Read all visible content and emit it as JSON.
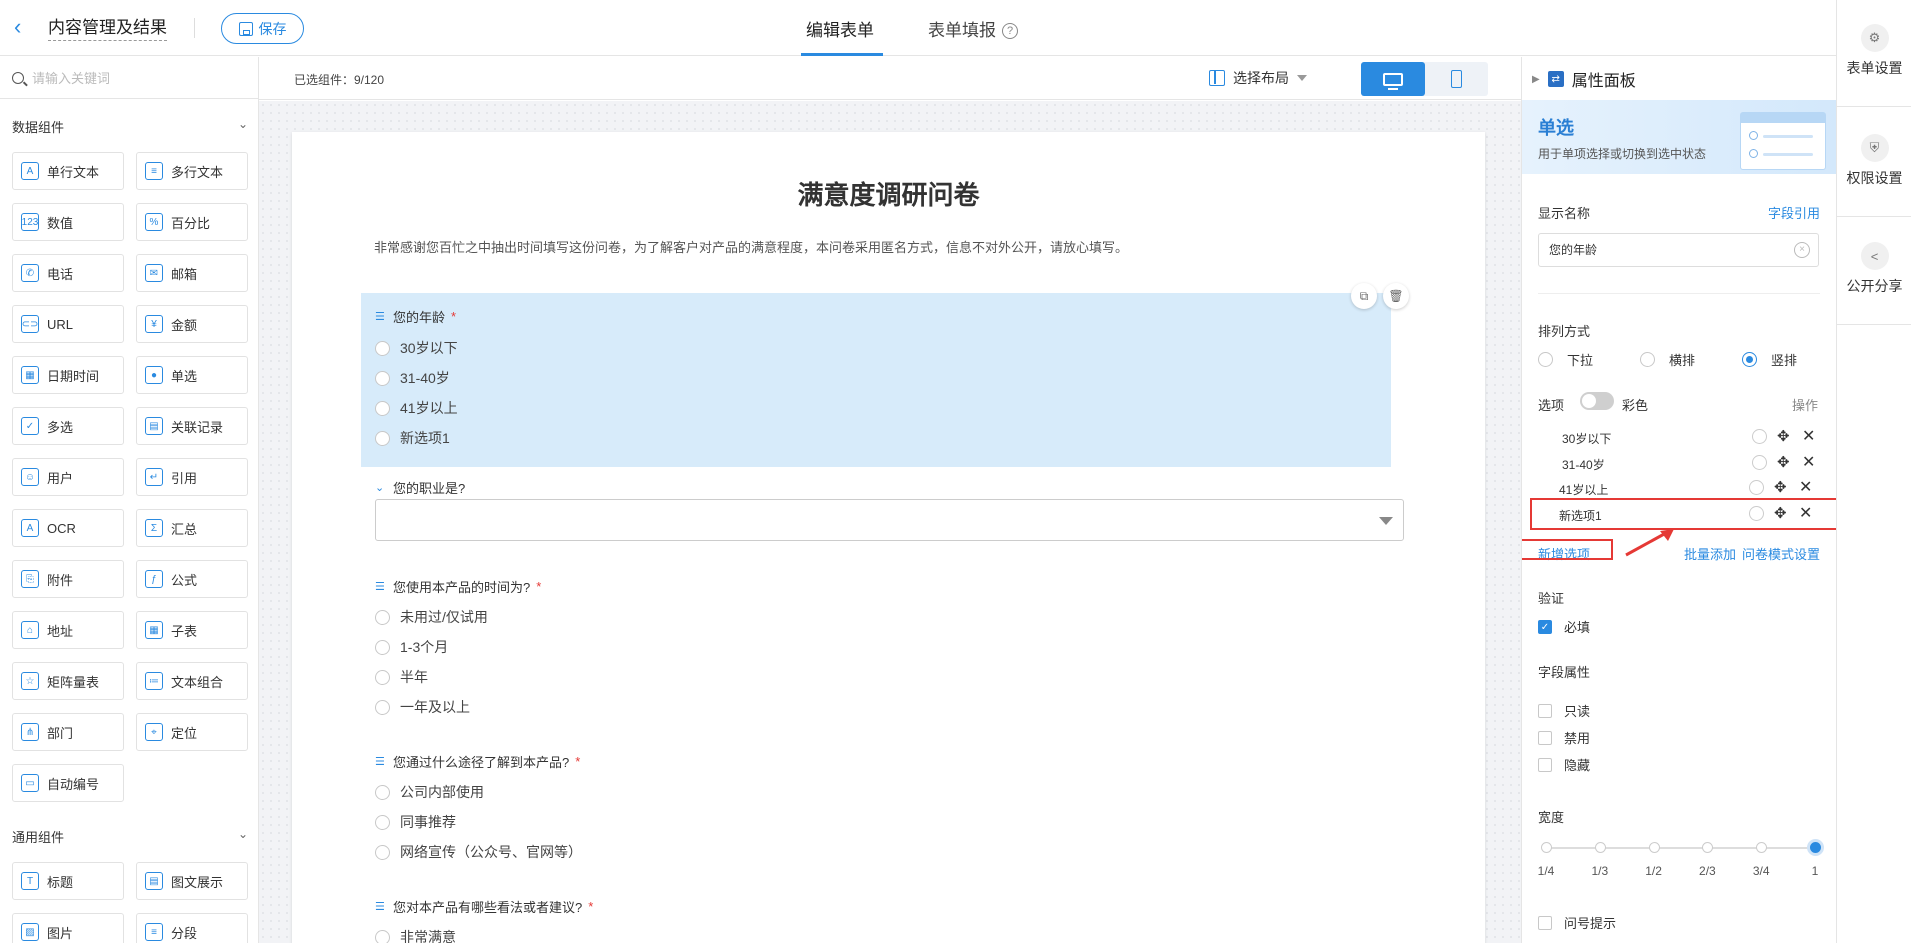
{
  "header": {
    "app_title": "内容管理及结果",
    "save_label": "保存",
    "tabs": [
      {
        "label": "编辑表单"
      },
      {
        "label": "表单填报"
      }
    ],
    "help_glyph": "?"
  },
  "right_rail": {
    "items": [
      {
        "label": "表单设置",
        "icon": "form-settings-icon"
      },
      {
        "label": "权限设置",
        "icon": "shield-icon"
      },
      {
        "label": "公开分享",
        "icon": "share-icon"
      }
    ]
  },
  "left_panel": {
    "search_placeholder": "请输入关键词",
    "section_data": "数据组件",
    "section_common": "通用组件",
    "components": [
      {
        "label": "单行文本",
        "glyph": "A"
      },
      {
        "label": "多行文本",
        "glyph": "≡"
      },
      {
        "label": "数值",
        "glyph": "123"
      },
      {
        "label": "百分比",
        "glyph": "%"
      },
      {
        "label": "电话",
        "glyph": "✆"
      },
      {
        "label": "邮箱",
        "glyph": "✉"
      },
      {
        "label": "URL",
        "glyph": "⊂⊃"
      },
      {
        "label": "金额",
        "glyph": "¥"
      },
      {
        "label": "日期时间",
        "glyph": "▦"
      },
      {
        "label": "单选",
        "glyph": "●"
      },
      {
        "label": "多选",
        "glyph": "✓"
      },
      {
        "label": "关联记录",
        "glyph": "▤"
      },
      {
        "label": "用户",
        "glyph": "☺"
      },
      {
        "label": "引用",
        "glyph": "↵"
      },
      {
        "label": "OCR",
        "glyph": "A"
      },
      {
        "label": "汇总",
        "glyph": "Σ"
      },
      {
        "label": "附件",
        "glyph": "⎘"
      },
      {
        "label": "公式",
        "glyph": "ƒ"
      },
      {
        "label": "地址",
        "glyph": "⌂"
      },
      {
        "label": "子表",
        "glyph": "▦"
      },
      {
        "label": "矩阵量表",
        "glyph": "☆"
      },
      {
        "label": "文本组合",
        "glyph": "≔"
      },
      {
        "label": "部门",
        "glyph": "⋔"
      },
      {
        "label": "定位",
        "glyph": "⌖"
      },
      {
        "label": "自动编号",
        "glyph": "▭"
      }
    ],
    "common_components": [
      {
        "label": "标题",
        "glyph": "T"
      },
      {
        "label": "图文展示",
        "glyph": "▤"
      },
      {
        "label": "图片",
        "glyph": "▨"
      },
      {
        "label": "分段",
        "glyph": "≡"
      }
    ]
  },
  "canvas_toolbar": {
    "selected_count": "已选组件：9/120",
    "layout_label": "选择布局"
  },
  "form": {
    "title": "满意度调研问卷",
    "description": "非常感谢您百忙之中抽出时间填写这份问卷，为了解客户对产品的满意程度，本问卷采用匿名方式，信息不对外公开，请放心填写。",
    "questions": [
      {
        "title": "您的年龄",
        "required": "*",
        "options": [
          "30岁以下",
          "31-40岁",
          "41岁以上",
          "新选项1"
        ]
      },
      {
        "title": "您的职业是?",
        "required": ""
      },
      {
        "title": "您使用本产品的时间为?",
        "required": "*",
        "options": [
          "未用过/仅试用",
          "1-3个月",
          "半年",
          "一年及以上"
        ]
      },
      {
        "title": "您通过什么途径了解到本产品?",
        "required": "*",
        "options": [
          "公司内部使用",
          "同事推荐",
          "网络宣传（公众号、官网等）"
        ]
      },
      {
        "title": "您对本产品有哪些看法或者建议?",
        "required": "*",
        "options": [
          "非常满意"
        ]
      }
    ]
  },
  "props": {
    "panel_title": "属性面板",
    "banner_title": "单选",
    "banner_desc": "用于单项选择或切换到选中状态",
    "display_name_label": "显示名称",
    "field_ref_link": "字段引用",
    "display_name_value": "您的年龄",
    "arrange_label": "排列方式",
    "arrange_options": [
      "下拉",
      "横排",
      "竖排"
    ],
    "options_label": "选项",
    "color_label": "彩色",
    "operate_label": "操作",
    "option_items": [
      "30岁以下",
      "31-40岁",
      "41岁以上",
      "新选项1"
    ],
    "add_option": "新增选项",
    "batch_add": "批量添加",
    "quiz_settings": "问卷模式设置",
    "validate_label": "验证",
    "required_label": "必填",
    "field_attr_label": "字段属性",
    "readonly_label": "只读",
    "disabled_label": "禁用",
    "hidden_label": "隐藏",
    "width_label": "宽度",
    "width_ticks": [
      "1/4",
      "1/3",
      "1/2",
      "2/3",
      "3/4",
      "1"
    ],
    "width_value": "1",
    "question_hint_label": "问号提示"
  }
}
